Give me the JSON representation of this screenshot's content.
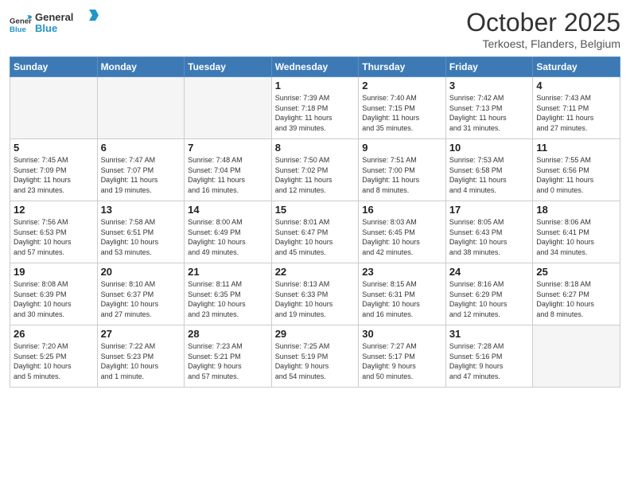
{
  "logo": {
    "line1": "General",
    "line2": "Blue"
  },
  "title": "October 2025",
  "location": "Terkoest, Flanders, Belgium",
  "weekdays": [
    "Sunday",
    "Monday",
    "Tuesday",
    "Wednesday",
    "Thursday",
    "Friday",
    "Saturday"
  ],
  "weeks": [
    [
      {
        "num": "",
        "info": ""
      },
      {
        "num": "",
        "info": ""
      },
      {
        "num": "",
        "info": ""
      },
      {
        "num": "1",
        "info": "Sunrise: 7:39 AM\nSunset: 7:18 PM\nDaylight: 11 hours\nand 39 minutes."
      },
      {
        "num": "2",
        "info": "Sunrise: 7:40 AM\nSunset: 7:15 PM\nDaylight: 11 hours\nand 35 minutes."
      },
      {
        "num": "3",
        "info": "Sunrise: 7:42 AM\nSunset: 7:13 PM\nDaylight: 11 hours\nand 31 minutes."
      },
      {
        "num": "4",
        "info": "Sunrise: 7:43 AM\nSunset: 7:11 PM\nDaylight: 11 hours\nand 27 minutes."
      }
    ],
    [
      {
        "num": "5",
        "info": "Sunrise: 7:45 AM\nSunset: 7:09 PM\nDaylight: 11 hours\nand 23 minutes."
      },
      {
        "num": "6",
        "info": "Sunrise: 7:47 AM\nSunset: 7:07 PM\nDaylight: 11 hours\nand 19 minutes."
      },
      {
        "num": "7",
        "info": "Sunrise: 7:48 AM\nSunset: 7:04 PM\nDaylight: 11 hours\nand 16 minutes."
      },
      {
        "num": "8",
        "info": "Sunrise: 7:50 AM\nSunset: 7:02 PM\nDaylight: 11 hours\nand 12 minutes."
      },
      {
        "num": "9",
        "info": "Sunrise: 7:51 AM\nSunset: 7:00 PM\nDaylight: 11 hours\nand 8 minutes."
      },
      {
        "num": "10",
        "info": "Sunrise: 7:53 AM\nSunset: 6:58 PM\nDaylight: 11 hours\nand 4 minutes."
      },
      {
        "num": "11",
        "info": "Sunrise: 7:55 AM\nSunset: 6:56 PM\nDaylight: 11 hours\nand 0 minutes."
      }
    ],
    [
      {
        "num": "12",
        "info": "Sunrise: 7:56 AM\nSunset: 6:53 PM\nDaylight: 10 hours\nand 57 minutes."
      },
      {
        "num": "13",
        "info": "Sunrise: 7:58 AM\nSunset: 6:51 PM\nDaylight: 10 hours\nand 53 minutes."
      },
      {
        "num": "14",
        "info": "Sunrise: 8:00 AM\nSunset: 6:49 PM\nDaylight: 10 hours\nand 49 minutes."
      },
      {
        "num": "15",
        "info": "Sunrise: 8:01 AM\nSunset: 6:47 PM\nDaylight: 10 hours\nand 45 minutes."
      },
      {
        "num": "16",
        "info": "Sunrise: 8:03 AM\nSunset: 6:45 PM\nDaylight: 10 hours\nand 42 minutes."
      },
      {
        "num": "17",
        "info": "Sunrise: 8:05 AM\nSunset: 6:43 PM\nDaylight: 10 hours\nand 38 minutes."
      },
      {
        "num": "18",
        "info": "Sunrise: 8:06 AM\nSunset: 6:41 PM\nDaylight: 10 hours\nand 34 minutes."
      }
    ],
    [
      {
        "num": "19",
        "info": "Sunrise: 8:08 AM\nSunset: 6:39 PM\nDaylight: 10 hours\nand 30 minutes."
      },
      {
        "num": "20",
        "info": "Sunrise: 8:10 AM\nSunset: 6:37 PM\nDaylight: 10 hours\nand 27 minutes."
      },
      {
        "num": "21",
        "info": "Sunrise: 8:11 AM\nSunset: 6:35 PM\nDaylight: 10 hours\nand 23 minutes."
      },
      {
        "num": "22",
        "info": "Sunrise: 8:13 AM\nSunset: 6:33 PM\nDaylight: 10 hours\nand 19 minutes."
      },
      {
        "num": "23",
        "info": "Sunrise: 8:15 AM\nSunset: 6:31 PM\nDaylight: 10 hours\nand 16 minutes."
      },
      {
        "num": "24",
        "info": "Sunrise: 8:16 AM\nSunset: 6:29 PM\nDaylight: 10 hours\nand 12 minutes."
      },
      {
        "num": "25",
        "info": "Sunrise: 8:18 AM\nSunset: 6:27 PM\nDaylight: 10 hours\nand 8 minutes."
      }
    ],
    [
      {
        "num": "26",
        "info": "Sunrise: 7:20 AM\nSunset: 5:25 PM\nDaylight: 10 hours\nand 5 minutes."
      },
      {
        "num": "27",
        "info": "Sunrise: 7:22 AM\nSunset: 5:23 PM\nDaylight: 10 hours\nand 1 minute."
      },
      {
        "num": "28",
        "info": "Sunrise: 7:23 AM\nSunset: 5:21 PM\nDaylight: 9 hours\nand 57 minutes."
      },
      {
        "num": "29",
        "info": "Sunrise: 7:25 AM\nSunset: 5:19 PM\nDaylight: 9 hours\nand 54 minutes."
      },
      {
        "num": "30",
        "info": "Sunrise: 7:27 AM\nSunset: 5:17 PM\nDaylight: 9 hours\nand 50 minutes."
      },
      {
        "num": "31",
        "info": "Sunrise: 7:28 AM\nSunset: 5:16 PM\nDaylight: 9 hours\nand 47 minutes."
      },
      {
        "num": "",
        "info": ""
      }
    ]
  ]
}
